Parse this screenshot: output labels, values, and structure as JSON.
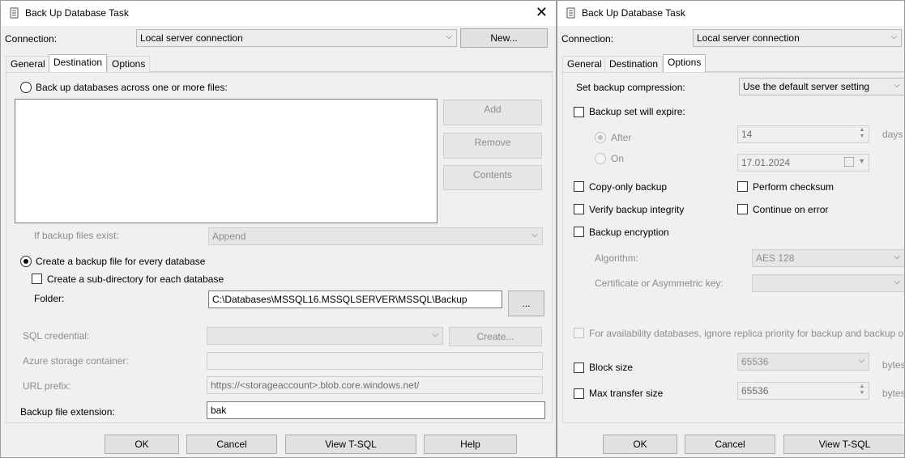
{
  "left": {
    "title": "Back Up Database Task",
    "connection_label": "Connection:",
    "connection_value": "Local server connection",
    "new_button": "New...",
    "tabs": [
      "General",
      "Destination",
      "Options"
    ],
    "across_files_label": "Back up databases across one or more files:",
    "add_button": "Add",
    "remove_button": "Remove",
    "contents_button": "Contents",
    "if_exists_label": "If backup files exist:",
    "if_exists_value": "Append",
    "create_per_db_label": "Create a backup file for every database",
    "subdir_label": "Create a sub-directory for each database",
    "folder_label": "Folder:",
    "folder_value": "C:\\Databases\\MSSQL16.MSSQLSERVER\\MSSQL\\Backup",
    "browse_button": "...",
    "sql_credential_label": "SQL credential:",
    "create_button": "Create...",
    "azure_container_label": "Azure storage container:",
    "url_prefix_label": "URL prefix:",
    "url_prefix_value": "https://<storageaccount>.blob.core.windows.net/",
    "extension_label": "Backup file extension:",
    "extension_value": "bak",
    "ok_button": "OK",
    "cancel_button": "Cancel",
    "tsql_button": "View T-SQL",
    "help_button": "Help"
  },
  "right": {
    "title": "Back Up Database Task",
    "connection_label": "Connection:",
    "connection_value": "Local server connection",
    "tabs": [
      "General",
      "Destination",
      "Options"
    ],
    "compression_label": "Set backup compression:",
    "compression_value": "Use the default server setting",
    "expire_label": "Backup set will expire:",
    "after_label": "After",
    "after_value": "14",
    "days_label": "days",
    "on_label": "On",
    "on_value": "17.01.2024",
    "copy_only_label": "Copy-only backup",
    "checksum_label": "Perform checksum",
    "verify_label": "Verify backup integrity",
    "continue_error_label": "Continue on error",
    "encryption_label": "Backup encryption",
    "algorithm_label": "Algorithm:",
    "algorithm_value": "AES 128",
    "certificate_label": "Certificate or Asymmetric key:",
    "availability_label": "For availability databases, ignore replica priority for backup and backup on",
    "block_size_label": "Block size",
    "block_size_value": "65536",
    "bytes_label": "bytes",
    "max_transfer_label": "Max transfer size",
    "max_transfer_value": "65536",
    "ok_button": "OK",
    "cancel_button": "Cancel",
    "tsql_button": "View T-SQL"
  }
}
